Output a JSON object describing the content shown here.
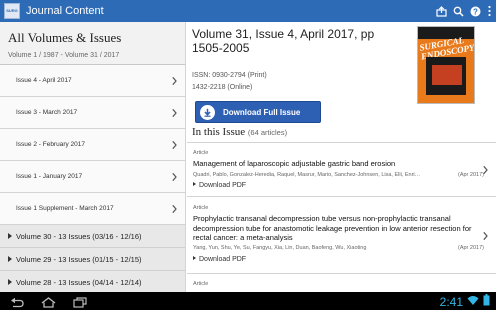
{
  "app": {
    "title": "Journal Content",
    "logo_text": "SURGICAL ENDOSCOPY"
  },
  "toolbar": {
    "share_icon": "share-icon",
    "search_icon": "search-icon",
    "help_icon": "help-icon",
    "menu_icon": "overflow-menu-icon"
  },
  "sidebar": {
    "title": "All Volumes & Issues",
    "subtitle": "Volume 1 / 1987 - Volume 31 / 2017",
    "issues": [
      {
        "label": "Issue 4 - April 2017"
      },
      {
        "label": "Issue 3 - March 2017"
      },
      {
        "label": "Issue 2 - February 2017"
      },
      {
        "label": "Issue 1 - January 2017"
      },
      {
        "label": "Issue 1 Supplement - March 2017"
      }
    ],
    "volumes": [
      {
        "label": "Volume 30 - 13 Issues (03/16 - 12/16)"
      },
      {
        "label": "Volume 29 - 13 Issues (01/15 - 12/15)"
      },
      {
        "label": "Volume 28 - 13 Issues (04/14 - 12/14)"
      }
    ]
  },
  "main": {
    "volume_heading": "Volume 31, Issue 4, April 2017, pp 1505-2005",
    "issn_print": "ISSN: 0930-2794 (Print)",
    "issn_online": "1432-2218 (Online)",
    "cover_title": "SURGICAL ENDOSCOPY",
    "download_button": "Download Full Issue",
    "in_this_issue": "In this Issue",
    "article_count": "(64 articles)",
    "articles": [
      {
        "type": "Article",
        "title": "Management of laparoscopic adjustable gastric band erosion",
        "authors": "Quadri, Pablo, Gonzalez-Heredia, Raquel, Masrur, Mario, Sanchez-Johnsen, Lisa, Elli, Enriqu...",
        "date": "(Apr 2017)",
        "download": "Download PDF"
      },
      {
        "type": "Article",
        "title": "Prophylactic transanal decompression tube versus non-prophylactic transanal decompression tube for anastomotic leakage prevention in low anterior resection for rectal cancer: a meta-analysis",
        "authors": "Yang, Yun, Shu, Ye, Su, Fangyu, Xia, Lin, Duan, Baofeng, Wu, Xiaoting",
        "date": "(Apr 2017)",
        "download": "Download PDF"
      },
      {
        "type": "Article"
      }
    ]
  },
  "system_bar": {
    "clock": "2:41",
    "back_icon": "back-icon",
    "home_icon": "home-icon",
    "recents_icon": "recent-apps-icon",
    "wifi_icon": "wifi-icon",
    "battery_icon": "battery-icon"
  }
}
